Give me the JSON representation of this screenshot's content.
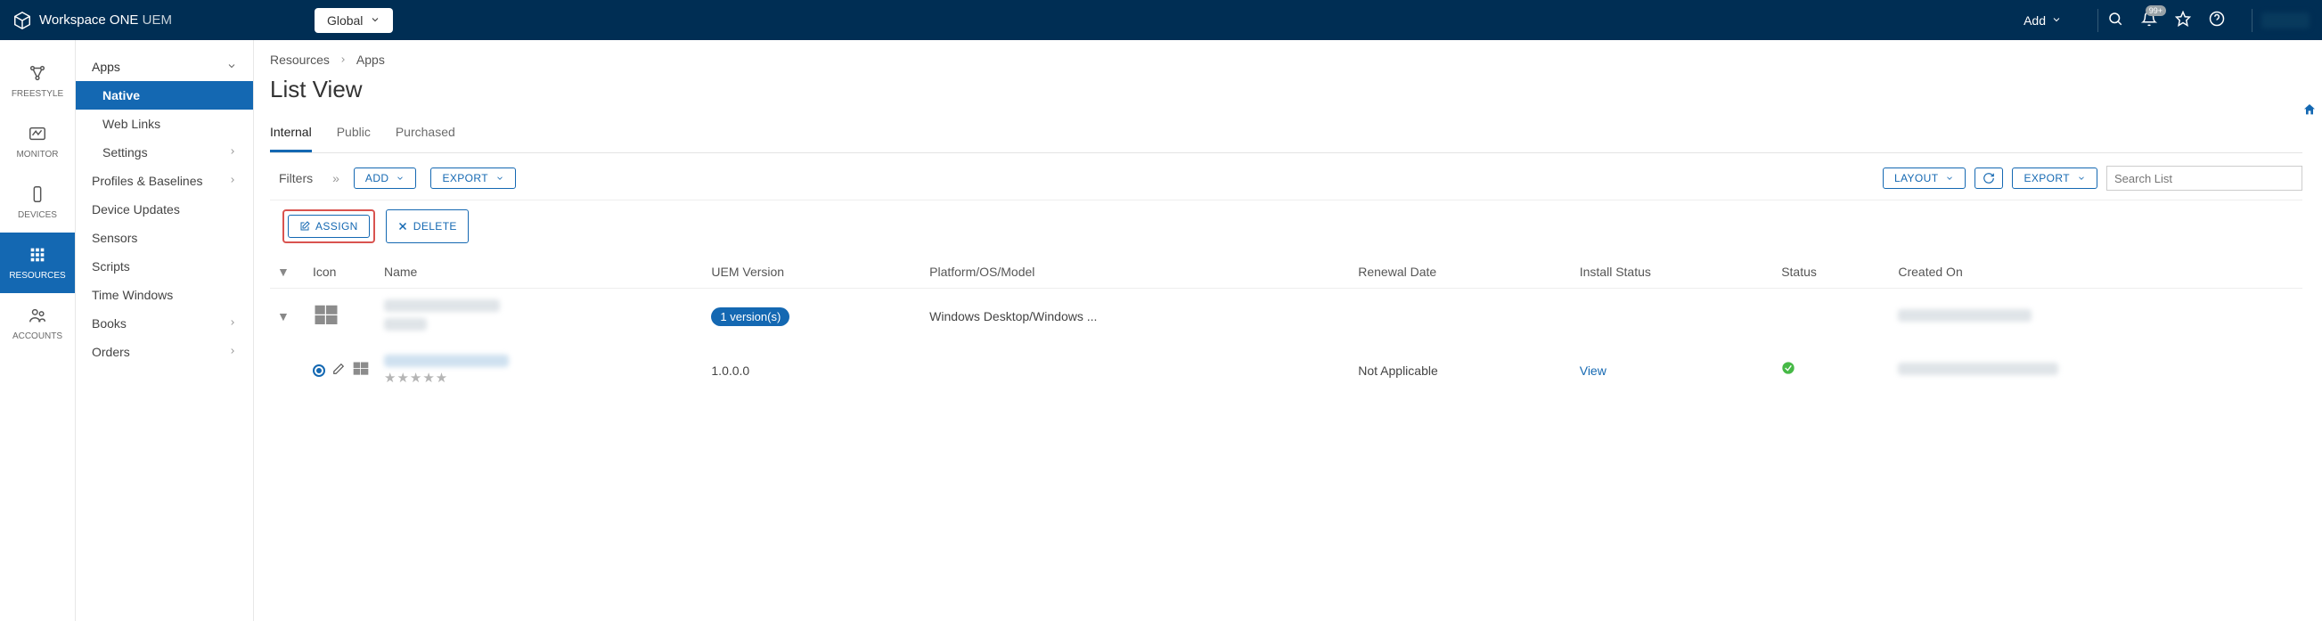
{
  "header": {
    "brand_main": "Workspace ONE",
    "brand_sub": "UEM",
    "org_group": "Global",
    "add_label": "Add",
    "notifications_badge": "99+"
  },
  "left_rail": {
    "items": [
      {
        "label": "FREESTYLE",
        "icon": "freestyle"
      },
      {
        "label": "MONITOR",
        "icon": "monitor"
      },
      {
        "label": "DEVICES",
        "icon": "devices"
      },
      {
        "label": "RESOURCES",
        "icon": "resources",
        "active": true
      },
      {
        "label": "ACCOUNTS",
        "icon": "accounts"
      }
    ]
  },
  "side_panel": {
    "header": "Apps",
    "items": [
      {
        "label": "Native",
        "sub": true,
        "active": true
      },
      {
        "label": "Web Links",
        "sub": true
      },
      {
        "label": "Settings",
        "chev": true,
        "sub": true
      },
      {
        "label": "Profiles & Baselines",
        "chev": true
      },
      {
        "label": "Device Updates"
      },
      {
        "label": "Sensors"
      },
      {
        "label": "Scripts"
      },
      {
        "label": "Time Windows"
      },
      {
        "label": "Books",
        "chev": true
      },
      {
        "label": "Orders",
        "chev": true
      }
    ]
  },
  "main": {
    "breadcrumb": [
      "Resources",
      "Apps"
    ],
    "title": "List View",
    "tabs": [
      "Internal",
      "Public",
      "Purchased"
    ],
    "active_tab": 0,
    "toolbar": {
      "filters_label": "Filters",
      "add_label": "ADD",
      "export_label": "EXPORT",
      "layout_label": "LAYOUT",
      "search_placeholder": "Search List"
    },
    "actions": {
      "assign_label": "ASSIGN",
      "delete_label": "DELETE"
    },
    "table": {
      "columns": [
        "",
        "Icon",
        "Name",
        "UEM Version",
        "Platform/OS/Model",
        "Renewal Date",
        "Install Status",
        "Status",
        "Created On"
      ],
      "parent_row": {
        "version_badge": "1 version(s)",
        "platform": "Windows Desktop/Windows ..."
      },
      "child_row": {
        "version": "1.0.0.0",
        "renewal": "Not Applicable",
        "install_status": "View"
      }
    }
  }
}
